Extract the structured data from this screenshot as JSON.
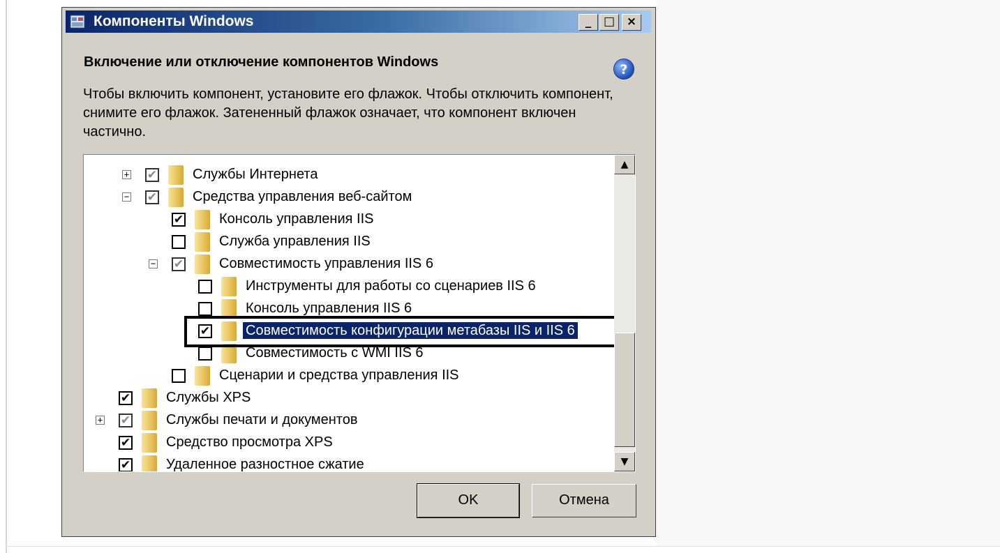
{
  "window": {
    "title": "Компоненты Windows",
    "controls": {
      "minimize": "_",
      "maximize": "□",
      "close": "×"
    }
  },
  "header": {
    "title": "Включение или отключение компонентов Windows",
    "help_icon": "?"
  },
  "description": "Чтобы включить компонент, установите его флажок. Чтобы отключить компонент, снимите его флажок. Затененный флажок означает, что компонент включен частично.",
  "tree": {
    "items": [
      {
        "label": "Службы Интернета",
        "expander": "+",
        "check": "partial"
      },
      {
        "label": "Средства управления веб-сайтом",
        "expander": "−",
        "check": "partial"
      },
      {
        "label": "Консоль управления IIS",
        "check": "checked"
      },
      {
        "label": "Служба управления IIS",
        "check": "unchecked"
      },
      {
        "label": "Совместимость управления IIS 6",
        "expander": "−",
        "check": "partial"
      },
      {
        "label": "Инструменты для работы со сценариев IIS 6",
        "check": "unchecked"
      },
      {
        "label": "Консоль управления IIS 6",
        "check": "unchecked"
      },
      {
        "label": "Совместимость конфигурации метабазы IIS и IIS 6",
        "check": "checked",
        "selected": true
      },
      {
        "label": "Совместимость с WMI IIS 6",
        "check": "unchecked"
      },
      {
        "label": "Сценарии и средства управления IIS",
        "check": "unchecked"
      },
      {
        "label": "Службы XPS",
        "check": "checked"
      },
      {
        "label": "Службы печати и документов",
        "expander": "+",
        "check": "partial"
      },
      {
        "label": "Средство просмотра XPS",
        "check": "checked"
      },
      {
        "label": "Удаленное разностное сжатие",
        "check": "checked"
      }
    ]
  },
  "icons": {
    "folder": "folder-icon",
    "window": "window-icon",
    "help": "help-icon"
  },
  "buttons": {
    "ok": "OK",
    "cancel": "Отмена"
  },
  "colors": {
    "titlebar_start": "#0a246a",
    "selection": "#0a246a",
    "dialog_bg": "#d4d0c8"
  }
}
